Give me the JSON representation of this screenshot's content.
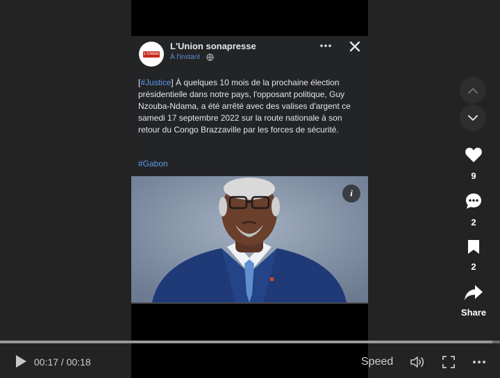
{
  "post": {
    "page_name": "L'Union sonapresse",
    "avatar_logo_text": "L'UNION",
    "timestamp": "À l'instant",
    "separator": "·",
    "text_tag": "#Justice",
    "text_bracket_open": "[",
    "text_bracket_close": "]",
    "text_body": " À quelques 10 mois de la prochaine élection présidentielle dans notre pays, l'opposant politique, Guy Nzouba-Ndama, a été arrêté avec des valises d'argent ce samedi 17 septembre 2022 sur la route nationale à son retour du Congo Brazzaville par les forces de sécurité.",
    "hashtag": "#Gabon",
    "info_label": "i"
  },
  "side": {
    "likes": "9",
    "comments": "2",
    "bookmarks": "2",
    "share_label": "Share"
  },
  "player": {
    "time": "00:17 / 00:18",
    "speed_label": "Speed",
    "progress_fraction": 0.985
  },
  "colors": {
    "background": "#232323",
    "post_background": "#232426",
    "hashtag": "#5b9bf0",
    "avatar_logo": "#c8291c"
  },
  "icons": [
    "more-options-icon",
    "close-icon",
    "globe-icon",
    "info-icon",
    "chevron-up-icon",
    "chevron-down-icon",
    "heart-icon",
    "comment-icon",
    "bookmark-icon",
    "share-icon",
    "play-icon",
    "volume-icon",
    "fullscreen-icon",
    "ellipsis-icon"
  ]
}
